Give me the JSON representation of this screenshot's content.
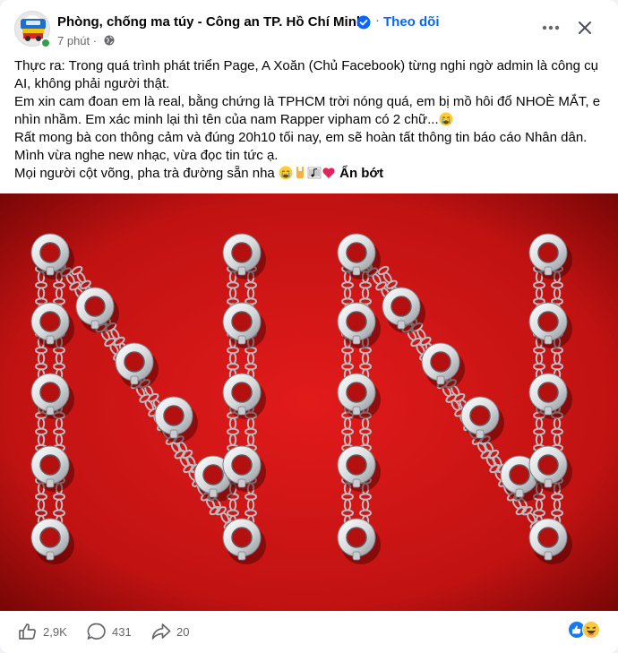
{
  "post": {
    "page_name": "Phòng, chống ma túy - Công an TP. Hồ Chí Minh",
    "separator": "·",
    "follow_label": "Theo dõi",
    "time_ago": "7 phút",
    "meta_dot": "·",
    "lines": [
      "Thực ra: Trong quá trình phát triển Page, A Xoăn (Chủ Facebook) từng nghi ngờ admin là công cụ",
      "AI, không phải người thật.",
      "Em xin cam đoan em là real, bằng chứng là TPHCM trời nóng quá, em bị mồ hôi đổ NHOÈ MẮT, e",
      "nhìn nhầm. Em xác minh lại thì tên của nam Rapper vipham có 2 chữ...",
      "Rất mong bà con thông cảm và đúng 20h10 tối nay, em sẽ hoàn tất thông tin báo cáo Nhân dân.",
      "Mình vừa nghe new nhạc, vừa đọc tin tức ạ.",
      "Mọi người cột võng, pha trà đường sẵn nha "
    ],
    "see_less_label": "Ẩn bớt"
  },
  "icons": {
    "verified": "verified-badge-icon",
    "globe": "globe-icon",
    "more": "more-horizontal-icon",
    "close": "close-icon",
    "like": "thumbs-up-icon",
    "comment": "comment-bubble-icon",
    "share": "share-arrow-icon"
  },
  "colors": {
    "accent": "#0866ff",
    "secondary_text": "#65676b",
    "image_red": "#d01818"
  },
  "stats": {
    "likes": "2,9K",
    "comments": "431",
    "shares": "20"
  }
}
